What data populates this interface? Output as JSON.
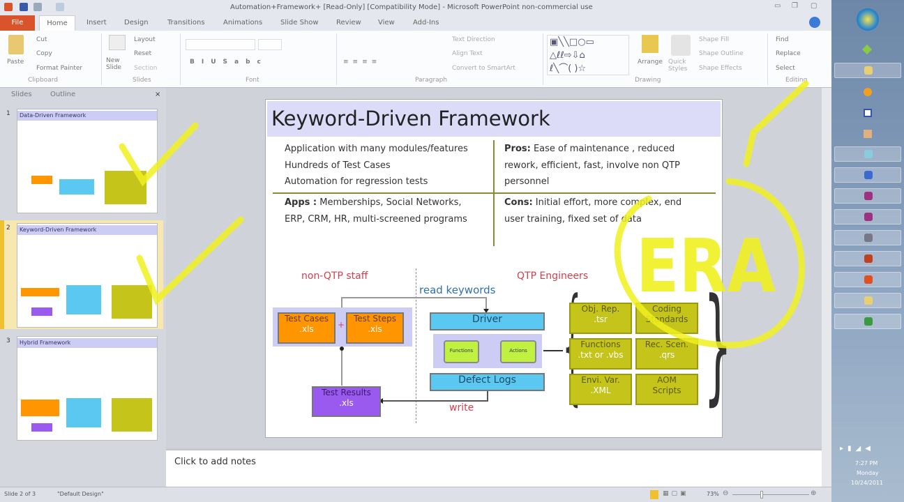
{
  "window": {
    "title": "Automation+Framework+ [Read-Only] [Compatibility Mode] - Microsoft PowerPoint non-commercial use"
  },
  "tabs": [
    "File",
    "Home",
    "Insert",
    "Design",
    "Transitions",
    "Animations",
    "Slide Show",
    "Review",
    "View",
    "Add-Ins"
  ],
  "ribbon": {
    "clipboard": {
      "paste": "Paste",
      "cut": "Cut",
      "copy": "Copy",
      "format_painter": "Format Painter",
      "label": "Clipboard"
    },
    "slides": {
      "new_slide": "New Slide",
      "layout": "Layout",
      "reset": "Reset",
      "section": "Section",
      "label": "Slides"
    },
    "font": {
      "label": "Font"
    },
    "paragraph": {
      "text_direction": "Text Direction",
      "align_text": "Align Text",
      "convert": "Convert to SmartArt",
      "label": "Paragraph"
    },
    "drawing": {
      "arrange": "Arrange",
      "quick_styles": "Quick Styles",
      "shape_fill": "Shape Fill",
      "shape_outline": "Shape Outline",
      "shape_effects": "Shape Effects",
      "label": "Drawing"
    },
    "editing": {
      "find": "Find",
      "replace": "Replace",
      "select": "Select",
      "label": "Editing"
    }
  },
  "pane": {
    "tabs": [
      "Slides",
      "Outline"
    ],
    "thumbs": [
      {
        "num": "1",
        "title": "Data-Driven Framework"
      },
      {
        "num": "2",
        "title": "Keyword-Driven Framework"
      },
      {
        "num": "3",
        "title": "Hybrid Framework"
      }
    ]
  },
  "slide": {
    "title": "Keyword-Driven Framework",
    "left_bullets": [
      "Application with many modules/features",
      "Hundreds of Test Cases",
      "Automation for regression tests"
    ],
    "apps_label": "Apps :",
    "apps_text": [
      "Memberships, Social Networks,",
      "ERP, CRM, HR, multi-screened programs"
    ],
    "pros_label": "Pros:",
    "pros_text": [
      " Ease of maintenance , reduced",
      "rework, efficient, fast, involve non QTP",
      "personnel"
    ],
    "cons_label": "Cons:",
    "cons_text": [
      " Initial effort, more complex, end",
      "user training, fixed set of data"
    ],
    "non_qtp": "non-QTP staff",
    "qtp": "QTP Engineers",
    "read_keywords": "read keywords",
    "write": "write",
    "test_cases": "Test Cases",
    "test_steps": "Test Steps",
    "xls": ".xls",
    "plus": "+",
    "driver": "Driver",
    "functions_small": "Functions",
    "actions_small": "Actions",
    "defect_logs": "Defect Logs",
    "test_results": "Test Results",
    "grid": [
      [
        "Obj. Rep.",
        ".tsr"
      ],
      [
        "Coding",
        "Standards"
      ],
      [
        "Functions",
        ".txt or .vbs"
      ],
      [
        "Rec. Scen.",
        ".qrs"
      ],
      [
        "Envi. Var.",
        ".XML"
      ],
      [
        "AOM",
        "Scripts"
      ]
    ],
    "annotation": "ERA"
  },
  "notes": {
    "placeholder": "Click to add notes"
  },
  "status": {
    "slide": "Slide 2 of 3",
    "theme": "\"Default Design\"",
    "zoom": "73%"
  },
  "clock": {
    "time": "7:27 PM",
    "day": "Monday",
    "date": "10/24/2011"
  }
}
